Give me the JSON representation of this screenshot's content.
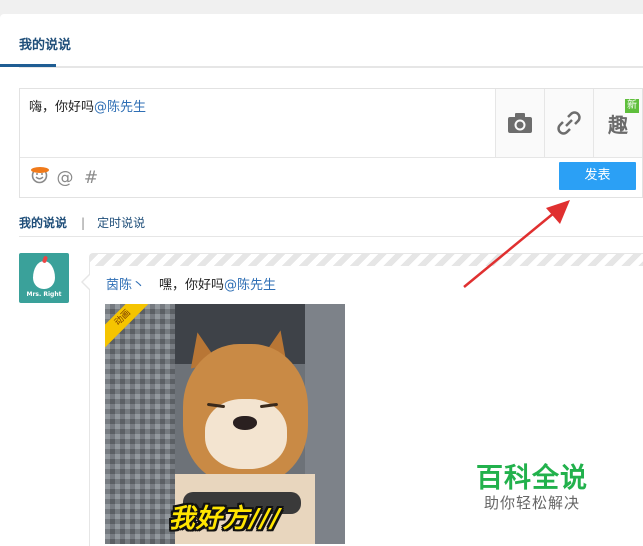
{
  "header": {
    "active_tab": "我的说说"
  },
  "composer": {
    "text_prefix": "嗨，你好吗",
    "mention": "@陈先生",
    "tools": [
      {
        "name": "camera-icon"
      },
      {
        "name": "link-icon"
      },
      {
        "name": "quxiang-icon",
        "label": "趣",
        "badge": "新"
      }
    ],
    "bottom_icons": [
      "smiley-icon",
      "at-icon",
      "hashtag-icon"
    ],
    "bottom_glyphs": {
      "at": "@",
      "hash": "#"
    },
    "publish_label": "发表"
  },
  "subtabs": {
    "mine": "我的说说",
    "separator": "|",
    "timed": "定时说说"
  },
  "post": {
    "avatar_text": "Mrs. Right",
    "author": "茵陈丶",
    "text_prefix": "嘿，你好吗",
    "mention": "@陈先生",
    "image": {
      "badge": "动画",
      "caption": "我好方///"
    }
  },
  "watermark": {
    "title": "百科全说",
    "subtitle": "助你轻松解决"
  },
  "colors": {
    "accent": "#2ba0f5",
    "link": "#2f6fb5",
    "tab": "#1f4e79",
    "arrow": "#e03030",
    "watermark": "#22b14c"
  }
}
